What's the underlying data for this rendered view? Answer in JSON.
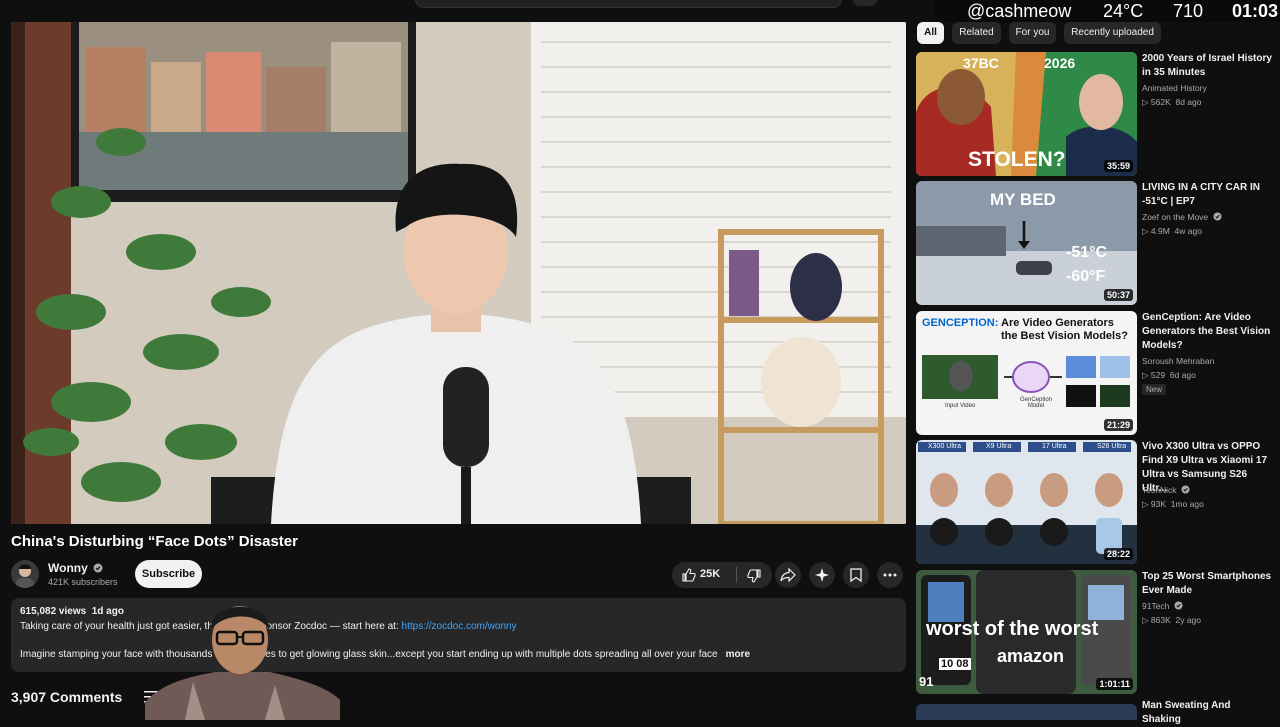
{
  "overlay": {
    "handle": "@cashmeow",
    "temp": "24°C",
    "count": "710",
    "clock": "01:03"
  },
  "video": {
    "title": "China's Disturbing “Face Dots” Disaster",
    "channel": "Wonny",
    "subscribers": "421K subscribers",
    "subscribe_label": "Subscribe",
    "likes": "25K"
  },
  "description": {
    "views": "615,082 views",
    "age": "1d ago",
    "line1_pre": "Taking care of your health just got easier, th",
    "line1_mid": "ponsor Zocdoc — start here at: ",
    "link": "https://zocdoc.com/wonny",
    "line2_pre": "Imagine stamping your face with thousands",
    "line2_post": "dles to get glowing glass skin...except you start ending up with multiple dots spreading all over your face",
    "more": "more"
  },
  "comments": {
    "count": "3,907 Comments"
  },
  "chips": [
    "All",
    "Related",
    "For you",
    "Recently uploaded"
  ],
  "related": [
    {
      "title": "2000 Years of Israel History in 35 Minutes",
      "channel": "Animated History",
      "verified": false,
      "views": "▷ 562K",
      "age": "8d ago",
      "duration": "35:59",
      "thumb_text": [
        "37BC",
        "2026",
        "STOLEN?"
      ]
    },
    {
      "title": "LIVING IN A CITY CAR IN -51°C | EP7",
      "channel": "Zoef on the Move",
      "verified": true,
      "views": "▷ 4.9M",
      "age": "4w ago",
      "duration": "50:37",
      "thumb_text": [
        "MY BED",
        "-51°C",
        "-60°F"
      ]
    },
    {
      "title": "GenCeption: Are Video Generators the Best Vision Models?",
      "channel": "Soroush Mehraban",
      "verified": false,
      "views": "▷ 529",
      "age": "6d ago",
      "badge": "New",
      "duration": "21:29",
      "thumb_text": [
        "GENCEPTION:",
        "Are Video Generators the Best Vision Models?",
        "Input Video",
        "GenCeption Model"
      ]
    },
    {
      "title": "Vivo X300 Ultra vs OPPO Find X9 Ultra vs Xiaomi 17 Ultra vs Samsung S26 Ultr...",
      "channel": "TechNick",
      "verified": true,
      "views": "▷ 93K",
      "age": "1mo ago",
      "duration": "28:22",
      "thumb_text": [
        "X300 Ultra",
        "X9 Ultra",
        "17 Ultra",
        "S26 Ultra"
      ]
    },
    {
      "title": "Top 25 Worst Smartphones Ever Made",
      "channel": "91Tech",
      "verified": true,
      "views": "▷ 863K",
      "age": "2y ago",
      "duration": "1:01:11",
      "thumb_text": [
        "worst of the worst",
        "amazon",
        "91",
        "10 08"
      ]
    },
    {
      "title": "Man Sweating And Shaking"
    }
  ],
  "colors": {
    "background": "#0f0f0f",
    "surface": "#272727",
    "link": "#3ea6ff",
    "text": "#f1f1f1",
    "muted": "#aaaaaa"
  }
}
